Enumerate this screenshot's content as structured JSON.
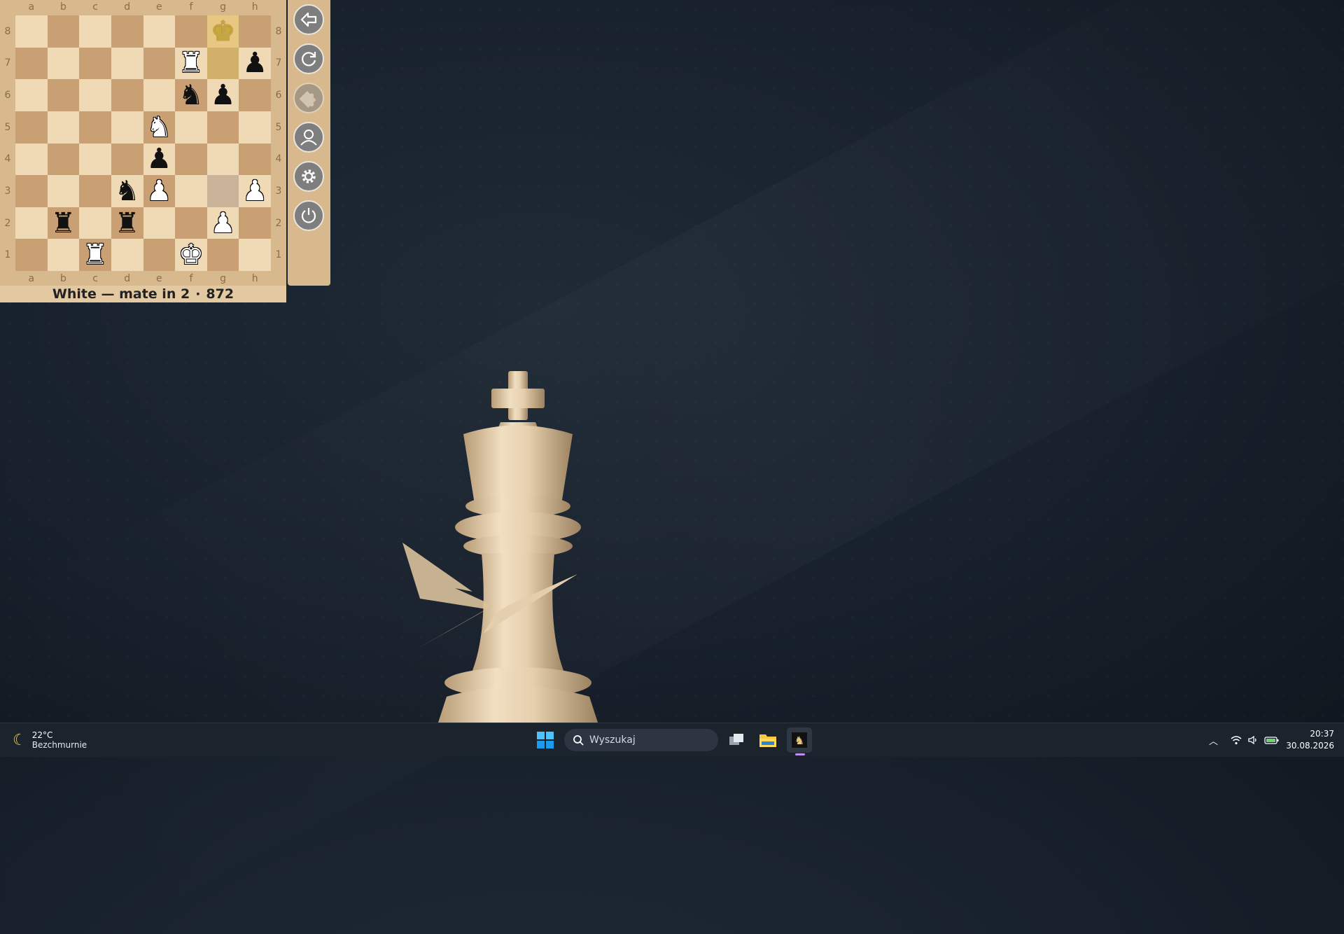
{
  "board": {
    "files": [
      "a",
      "b",
      "c",
      "d",
      "e",
      "f",
      "g",
      "h"
    ],
    "ranks": [
      "8",
      "7",
      "6",
      "5",
      "4",
      "3",
      "2",
      "1"
    ],
    "pieces": [
      {
        "square": "g8",
        "glyph": "♚",
        "color": "gold"
      },
      {
        "square": "f7",
        "glyph": "♜",
        "color": "white"
      },
      {
        "square": "h7",
        "glyph": "♟",
        "color": "black"
      },
      {
        "square": "f6",
        "glyph": "♞",
        "color": "black"
      },
      {
        "square": "g6",
        "glyph": "♟",
        "color": "black"
      },
      {
        "square": "e5",
        "glyph": "♞",
        "color": "white"
      },
      {
        "square": "e4",
        "glyph": "♟",
        "color": "black"
      },
      {
        "square": "d3",
        "glyph": "♞",
        "color": "black"
      },
      {
        "square": "e3",
        "glyph": "♟",
        "color": "white"
      },
      {
        "square": "h3",
        "glyph": "♟",
        "color": "white"
      },
      {
        "square": "b2",
        "glyph": "♜",
        "color": "black"
      },
      {
        "square": "d2",
        "glyph": "♜",
        "color": "black"
      },
      {
        "square": "g2",
        "glyph": "♟",
        "color": "white"
      },
      {
        "square": "c1",
        "glyph": "♜",
        "color": "white"
      },
      {
        "square": "f1",
        "glyph": "♚",
        "color": "white"
      }
    ],
    "highlights": [
      {
        "square": "g7",
        "kind": "from"
      },
      {
        "square": "g8",
        "kind": "to"
      },
      {
        "square": "g3",
        "kind": "grey"
      }
    ]
  },
  "status": {
    "text": "White — mate in 2",
    "separator": "·",
    "puzzle_number": "872"
  },
  "toolbar": {
    "buttons": [
      {
        "name": "back-button",
        "icon": "arrow-left-icon",
        "enabled": true
      },
      {
        "name": "reset-button",
        "icon": "refresh-icon",
        "enabled": true
      },
      {
        "name": "puzzle-button",
        "icon": "puzzle-icon",
        "enabled": false
      },
      {
        "name": "profile-button",
        "icon": "user-icon",
        "enabled": true
      },
      {
        "name": "settings-button",
        "icon": "gear-icon",
        "enabled": true
      },
      {
        "name": "power-button",
        "icon": "power-icon",
        "enabled": true
      }
    ]
  },
  "taskbar": {
    "weather": {
      "temp": "22°C",
      "desc": "Bezchmurnie",
      "icon": "moon-icon"
    },
    "search_placeholder": "Wyszukaj",
    "clock": {
      "time": "20:37",
      "date": "30.08.2026"
    },
    "tray_icons": [
      "chevron-up-icon",
      "wifi-icon",
      "volume-icon",
      "battery-icon"
    ],
    "apps": [
      "windows-start-icon",
      "task-view-icon",
      "file-explorer-icon",
      "chess-app-icon"
    ]
  },
  "colors": {
    "board_light": "#f0d9b5",
    "board_dark": "#c8a074",
    "frame": "#d7b98d",
    "desktop_bg": "#1a232e"
  }
}
